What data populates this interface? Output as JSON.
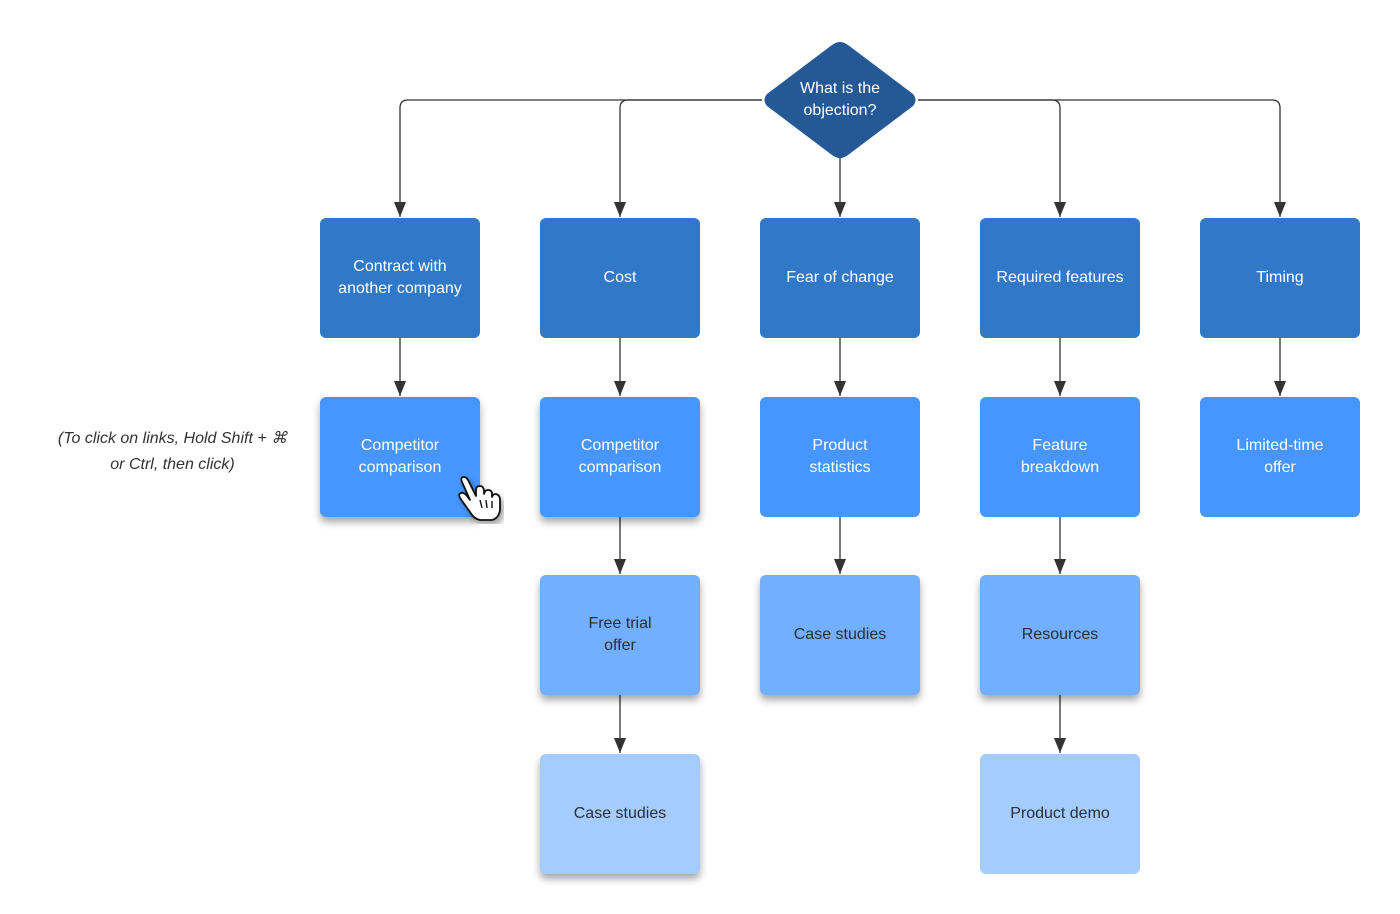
{
  "diagram": {
    "type": "flowchart",
    "hint_text": "(To click on links, Hold Shift + ⌘\nor Ctrl, then click)",
    "colors": {
      "decision": "#245996",
      "level_1": "#3178c9",
      "level_2": "#4796ff",
      "level_3": "#72afff",
      "level_4": "#a4ccff",
      "connector": "#333333"
    },
    "root": {
      "id": "objection",
      "label": "What is the\nobjection?",
      "shape": "diamond"
    },
    "columns": [
      {
        "nodes": [
          {
            "id": "contract",
            "label": "Contract with\nanother company",
            "level": 1
          },
          {
            "id": "competitor-1",
            "label": "Competitor\ncomparison",
            "level": 2,
            "link": true
          }
        ]
      },
      {
        "nodes": [
          {
            "id": "cost",
            "label": "Cost",
            "level": 1
          },
          {
            "id": "competitor-2",
            "label": "Competitor\ncomparison",
            "level": 2,
            "link": true
          },
          {
            "id": "free-trial",
            "label": "Free trial\noffer",
            "level": 3,
            "link": true
          },
          {
            "id": "case-studies-1",
            "label": "Case studies",
            "level": 4,
            "link": true
          }
        ]
      },
      {
        "nodes": [
          {
            "id": "fear",
            "label": "Fear of change",
            "level": 1
          },
          {
            "id": "product-stats",
            "label": "Product\nstatistics",
            "level": 2
          },
          {
            "id": "case-studies-2",
            "label": "Case studies",
            "level": 3,
            "link": true
          }
        ]
      },
      {
        "nodes": [
          {
            "id": "required-features",
            "label": "Required features",
            "level": 1
          },
          {
            "id": "feature-breakdown",
            "label": "Feature\nbreakdown",
            "level": 2
          },
          {
            "id": "resources",
            "label": "Resources",
            "level": 3,
            "link": true
          },
          {
            "id": "product-demo",
            "label": "Product demo",
            "level": 4
          }
        ]
      },
      {
        "nodes": [
          {
            "id": "timing",
            "label": "Timing",
            "level": 1
          },
          {
            "id": "limited-offer",
            "label": "Limited-time\noffer",
            "level": 2
          }
        ]
      }
    ],
    "cursor_icon": "hand-pointer-icon"
  }
}
